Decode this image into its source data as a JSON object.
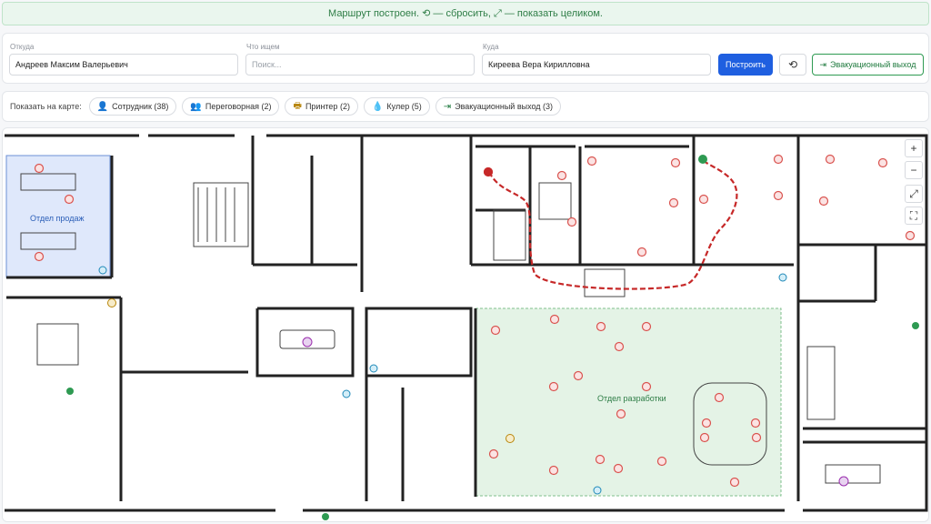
{
  "banner": {
    "text": "Маршрут построен. ⟲ — сбросить, ⤢ — показать целиком."
  },
  "route_form": {
    "from_label": "Откуда",
    "from_value": "Андреев Максим Валерьевич",
    "what_label": "Что ищем",
    "what_placeholder": "Поиск...",
    "to_label": "Куда",
    "to_value": "Киреева Вера Кирилловна",
    "build_label": "Построить",
    "reset_icon": "reset-icon",
    "exit_label": "Эвакуационный выход",
    "exit_icon": "exit-icon"
  },
  "filters": {
    "label": "Показать на карте:",
    "chips": [
      {
        "icon": "person-icon",
        "glyph": "👤",
        "label": "Сотрудник (38)",
        "color": "#c0392b"
      },
      {
        "icon": "meeting-room-icon",
        "glyph": "👥",
        "label": "Переговорная (2)",
        "color": "#9b2fae"
      },
      {
        "icon": "printer-icon",
        "glyph": "🖶",
        "label": "Принтер (2)",
        "color": "#b8860b"
      },
      {
        "icon": "cooler-icon",
        "glyph": "💧",
        "label": "Кулер (5)",
        "color": "#1e88b8"
      },
      {
        "icon": "exit-icon",
        "glyph": "⇥",
        "label": "Эвакуационный выход (3)",
        "color": "#1f7a3e"
      }
    ]
  },
  "map": {
    "zones": [
      {
        "name": "Отдел продаж",
        "color": "#2c5fb8"
      },
      {
        "name": "Отдел разработки",
        "color": "#2e7d46"
      }
    ],
    "zoom_controls": [
      "+",
      "−",
      "⤢",
      "⛶"
    ],
    "colors": {
      "route": "#c62828",
      "sales_zone": "#dfe8fb",
      "dev_zone": "#e4f3e6",
      "wall": "#222222",
      "employee": "#d9534f"
    }
  }
}
